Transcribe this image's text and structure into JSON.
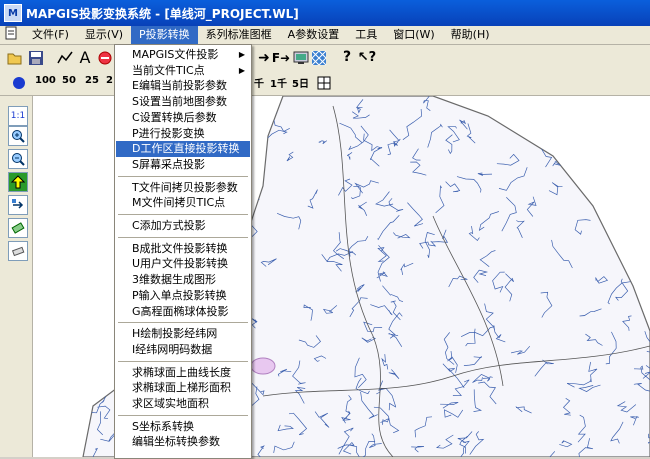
{
  "window": {
    "title": "MAPGIS投影变换系统 - [单线河_PROJECT.WL]",
    "icon": "mapgis-app-icon"
  },
  "menubar": {
    "items": [
      {
        "label": "文件(F)",
        "id": "file"
      },
      {
        "label": "显示(V)",
        "id": "view"
      },
      {
        "label": "P投影转换",
        "id": "projection",
        "active": true
      },
      {
        "label": "系列标准图框",
        "id": "std-frame"
      },
      {
        "label": "A参数设置",
        "id": "params"
      },
      {
        "label": "工具",
        "id": "tools"
      },
      {
        "label": "窗口(W)",
        "id": "window"
      },
      {
        "label": "帮助(H)",
        "id": "help"
      }
    ]
  },
  "toolbar1": {
    "icons": [
      "open-icon",
      "save-icon",
      "polyline-icon",
      "text-icon",
      "delete-icon",
      "point-projection-icon",
      "forward-projection-icon",
      "display-icon",
      "grid-pattern-icon",
      "help-icon",
      "context-help-icon"
    ]
  },
  "toolbar2": {
    "scale_labels": [
      "100",
      "50",
      "25",
      "2",
      "千",
      "1千",
      "5日"
    ],
    "icons": [
      "blue-dot-icon",
      "table-grid-icon"
    ]
  },
  "left_toolbar": {
    "icons": [
      "zoom-1to1-icon",
      "zoom-in-icon",
      "zoom-out-icon",
      "up-arrow-icon",
      "move-icon",
      "measure-icon",
      "eraser-icon"
    ],
    "label_1to1": "1:1"
  },
  "dropdown": {
    "items": [
      {
        "label": "MAPGIS文件投影",
        "submenu": true
      },
      {
        "label": "当前文件TIC点",
        "submenu": true
      },
      {
        "label": "E编辑当前投影参数"
      },
      {
        "label": "S设置当前地图参数"
      },
      {
        "label": "C设置转换后参数"
      },
      {
        "label": "P进行投影变换"
      },
      {
        "label": "D工作区直接投影转换",
        "highlighted": true
      },
      {
        "label": "S屏幕采点投影"
      },
      {
        "sep": true
      },
      {
        "label": "T文件间拷贝投影参数"
      },
      {
        "label": "M文件间拷贝TIC点"
      },
      {
        "sep": true
      },
      {
        "label": "C添加方式投影"
      },
      {
        "sep": true
      },
      {
        "label": "B成批文件投影转换"
      },
      {
        "label": "U用户文件投影转换"
      },
      {
        "label": "3维数据生成图形"
      },
      {
        "label": "P输入单点投影转换"
      },
      {
        "label": "G高程面椭球体投影"
      },
      {
        "sep": true
      },
      {
        "label": "H绘制投影经纬网"
      },
      {
        "label": "I经纬网明码数据"
      },
      {
        "sep": true
      },
      {
        "label": "求椭球面上曲线长度"
      },
      {
        "label": "求椭球面上梯形面积"
      },
      {
        "label": "求区域实地面积"
      },
      {
        "sep": true
      },
      {
        "label": "S坐标系转换"
      },
      {
        "label": "编辑坐标转换参数"
      }
    ]
  },
  "colors": {
    "title": "#0a4fd0",
    "highlight": "#316ac5",
    "map_line": "#3b5fae",
    "map_road": "#555555"
  }
}
